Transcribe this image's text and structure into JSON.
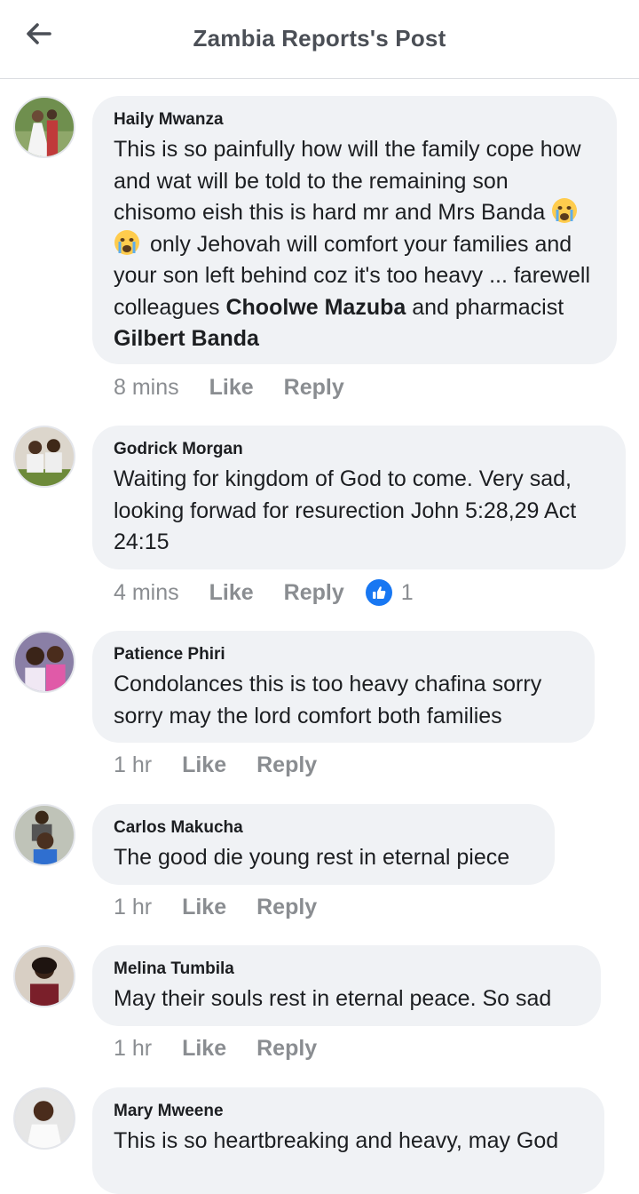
{
  "header": {
    "title": "Zambia Reports's Post",
    "back_icon": "arrow-left-icon"
  },
  "comments": [
    {
      "author": "Haily Mwanza",
      "text": {
        "p1": "This is so painfully how will the family cope how and wat will be told to the remaining son chisomo eish this is hard mr and Mrs Banda",
        "emoji": "crying-face",
        "p2": "only Jehovah will comfort your families and your son left behind coz it's too heavy ... farewell colleagues",
        "mention1": "Choolwe Mazuba",
        "p3": "and pharmacist",
        "mention2": "Gilbert Banda"
      },
      "time": "8 mins",
      "like": "Like",
      "reply": "Reply"
    },
    {
      "author": "Godrick Morgan",
      "text": "Waiting for kingdom of God to come. Very sad, looking forwad for resurection John 5:28,29 Act 24:15",
      "time": "4 mins",
      "like": "Like",
      "reply": "Reply",
      "reaction": {
        "icon": "thumbs-up-icon",
        "count": "1"
      }
    },
    {
      "author": "Patience Phiri",
      "text": "Condolances this is too heavy chafina sorry sorry may the lord comfort both families",
      "time": "1 hr",
      "like": "Like",
      "reply": "Reply"
    },
    {
      "author": "Carlos Makucha",
      "text": "The good die young rest in eternal piece",
      "time": "1 hr",
      "like": "Like",
      "reply": "Reply"
    },
    {
      "author": "Melina Tumbila",
      "text": "May their souls rest in eternal peace. So sad",
      "time": "1 hr",
      "like": "Like",
      "reply": "Reply"
    },
    {
      "author": "Mary Mweene",
      "text": "This is so heartbreaking and heavy, may God",
      "time": "",
      "like": "",
      "reply": ""
    }
  ],
  "colors": {
    "bubble": "#f0f2f5",
    "meta": "#8a8d91",
    "like_blue": "#1877f2",
    "header_text": "#4b4f56"
  }
}
